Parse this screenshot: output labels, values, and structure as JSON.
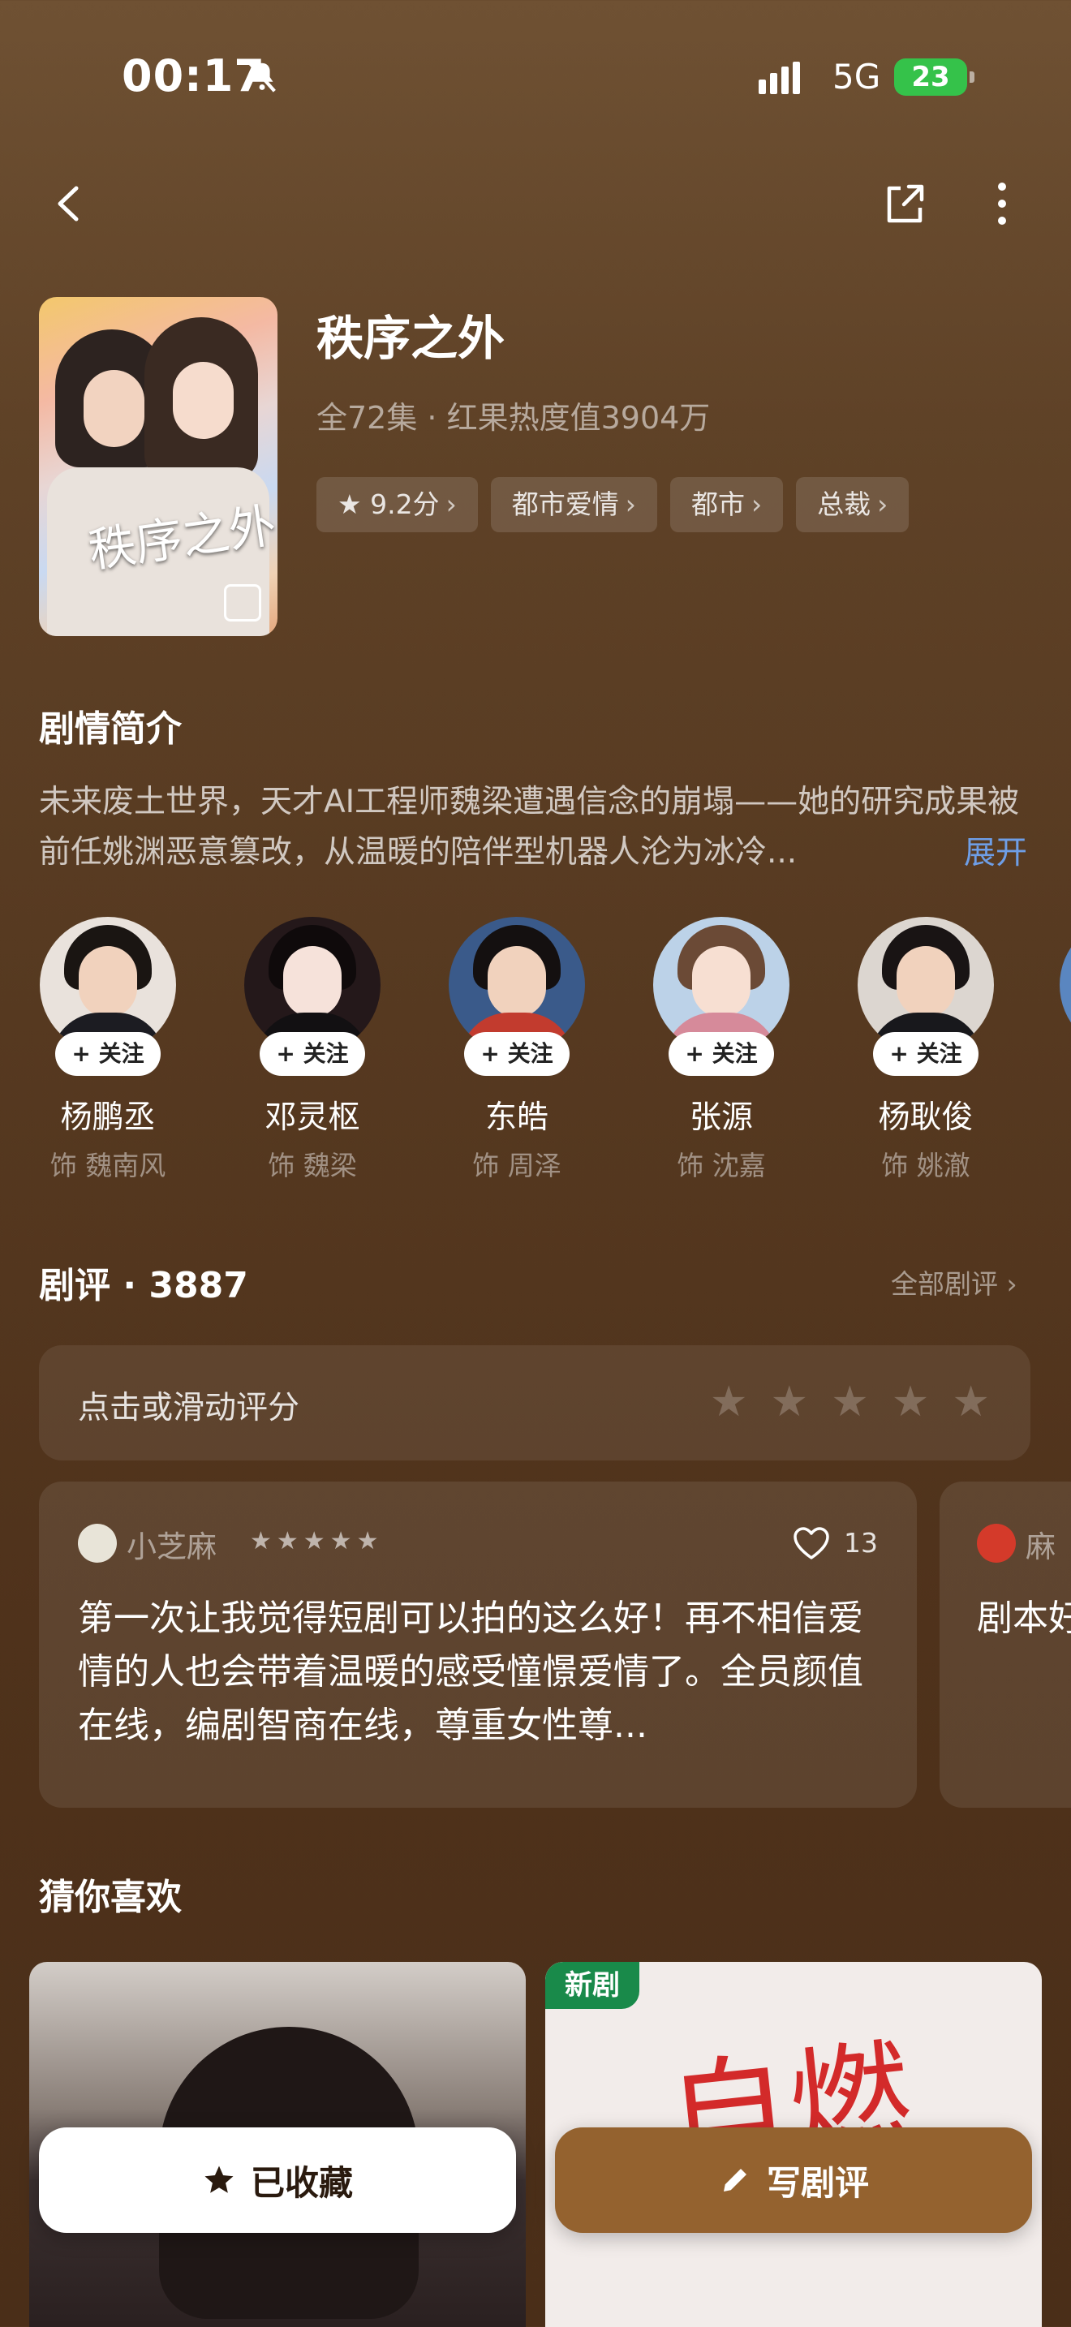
{
  "status_bar": {
    "time": "00:17",
    "network": "5G",
    "battery": "23"
  },
  "drama": {
    "title": "秩序之外",
    "subtitle": "全72集 · 红果热度值3904万",
    "poster_title": "秩序之外",
    "tags": [
      "9.2分",
      "都市爱情",
      "都市",
      "总裁"
    ]
  },
  "synopsis": {
    "heading": "剧情简介",
    "text": "未来废土世界，天才AI工程师魏梁遭遇信念的崩塌——她的研究成果被前任姚渊恶意篡改，从温暖的陪伴型机器人沦为冰冷...",
    "expand_label": "展开"
  },
  "cast": [
    {
      "name": "杨鹏丞",
      "role": "饰 魏南风",
      "follow": "+ 关注"
    },
    {
      "name": "邓灵枢",
      "role": "饰 魏梁",
      "follow": "+ 关注"
    },
    {
      "name": "东皓",
      "role": "饰 周泽",
      "follow": "+ 关注"
    },
    {
      "name": "张源",
      "role": "饰 沈嘉",
      "follow": "+ 关注"
    },
    {
      "name": "杨耿俊",
      "role": "饰 姚澈",
      "follow": "+ 关注"
    }
  ],
  "reviews": {
    "heading": "剧评 · 3887",
    "all_label": "全部剧评 ›",
    "rate_prompt": "点击或滑动评分",
    "items": [
      {
        "user": "小芝麻",
        "stars": 5,
        "likes": "13",
        "text": "第一次让我觉得短剧可以拍的这么好！再不相信爱情的人也会带着温暖的感受憧憬爱情了。全员颜值在线，编剧智商在线，尊重女性尊..."
      },
      {
        "user": "麻",
        "text": "剧本好"
      }
    ]
  },
  "recommend": {
    "heading": "猜你喜欢",
    "new_tag": "新剧",
    "card2_art": "自燃"
  },
  "actions": {
    "collect": "已收藏",
    "write": "写剧评"
  },
  "colors": {
    "accent_blue": "#6e9ee6",
    "write_button": "#94622f",
    "new_tag": "#198a4a",
    "battery": "#35c24a"
  }
}
